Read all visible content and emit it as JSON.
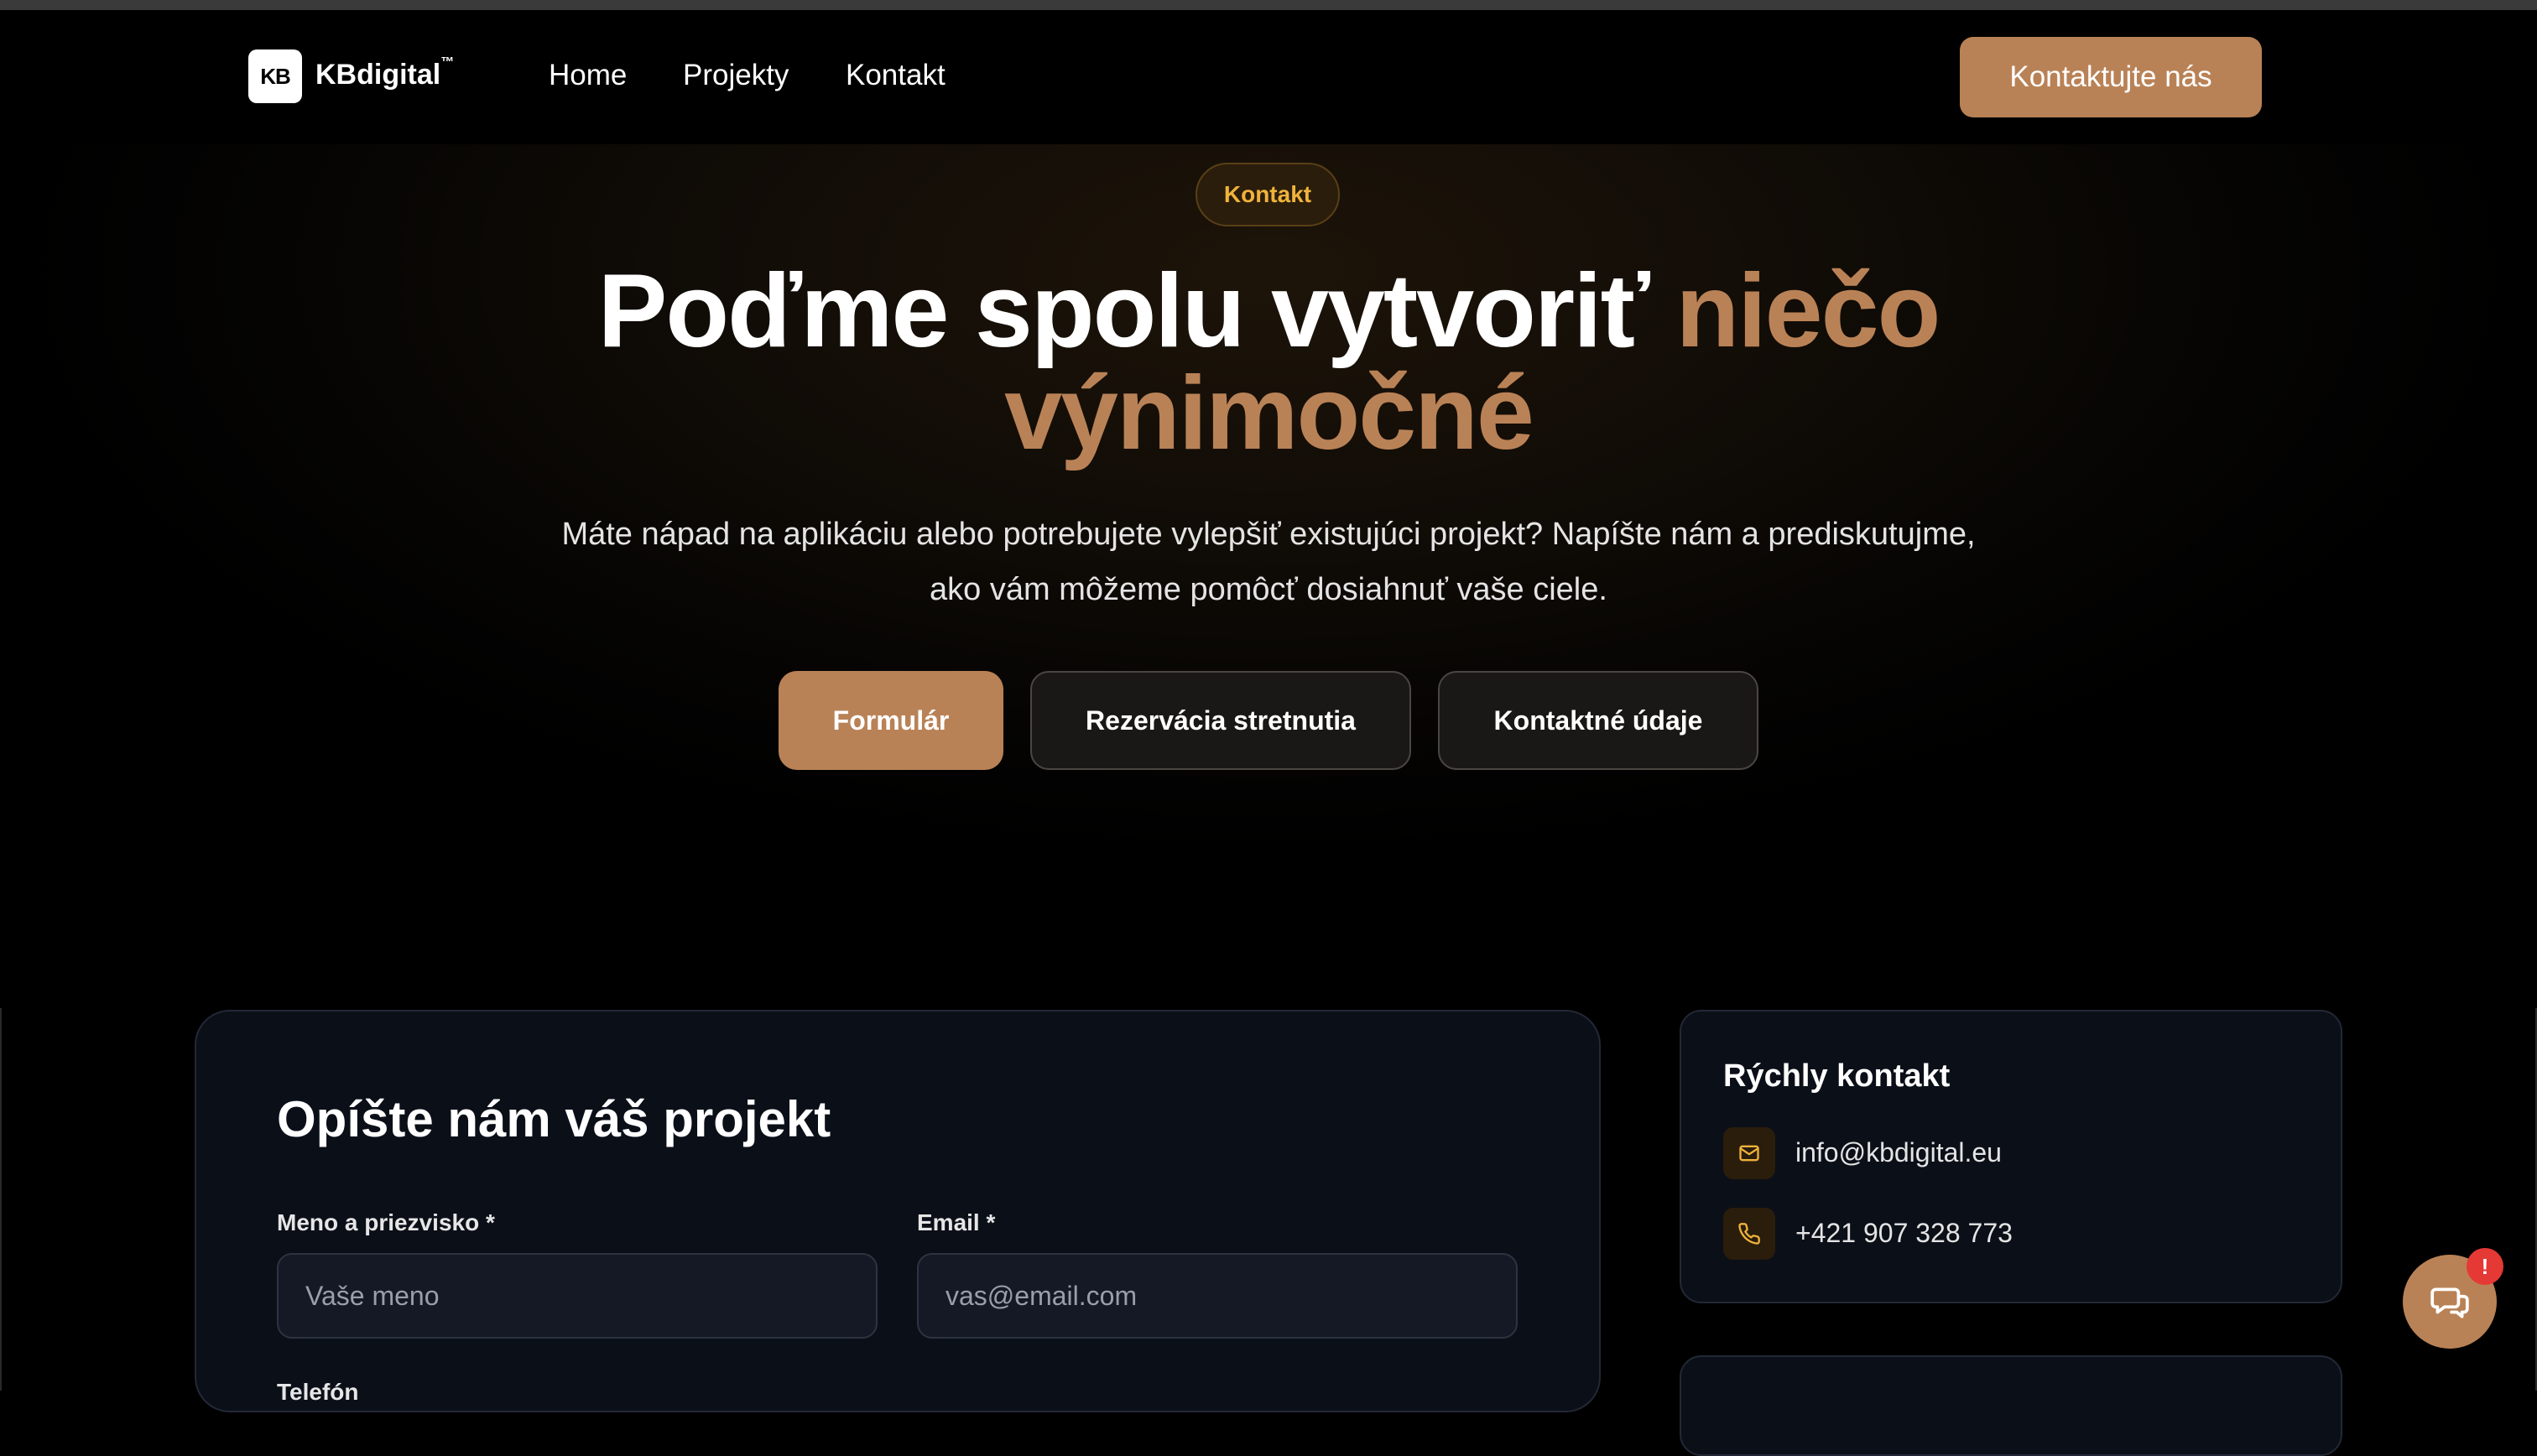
{
  "nav": {
    "logo_mark": "KB",
    "logo_name": "KBdigital",
    "logo_tm": "™",
    "links": [
      {
        "label": "Home"
      },
      {
        "label": "Projekty"
      },
      {
        "label": "Kontakt"
      }
    ],
    "cta_label": "Kontaktujte nás"
  },
  "hero": {
    "badge": "Kontakt",
    "title_plain": "Poďme spolu vytvoriť ",
    "title_accent_1": "niečo",
    "title_accent_2": "výnimočné",
    "subtitle_line1": "Máte nápad na aplikáciu alebo potrebujete vylepšiť existujúci projekt? Napíšte nám a prediskutujme,",
    "subtitle_line2": "ako vám môžeme pomôcť dosiahnuť vaše ciele.",
    "buttons": [
      {
        "label": "Formulár"
      },
      {
        "label": "Rezervácia stretnutia"
      },
      {
        "label": "Kontaktné údaje"
      }
    ]
  },
  "form": {
    "title": "Opíšte nám váš projekt",
    "name_label": "Meno a priezvisko *",
    "name_placeholder": "Vaše meno",
    "email_label": "Email *",
    "email_placeholder": "vas@email.com",
    "phone_label": "Telefón"
  },
  "quick_contact": {
    "title": "Rýchly kontakt",
    "email": "info@kbdigital.eu",
    "phone": "+421 907 328 773"
  },
  "chat": {
    "badge": "!"
  },
  "colors": {
    "accent": "#b98256",
    "badge_text": "#f0b33a",
    "card_bg": "#0b0f18",
    "notification": "#e53935"
  },
  "icons": [
    "mail-icon",
    "phone-icon",
    "chat-icon"
  ]
}
